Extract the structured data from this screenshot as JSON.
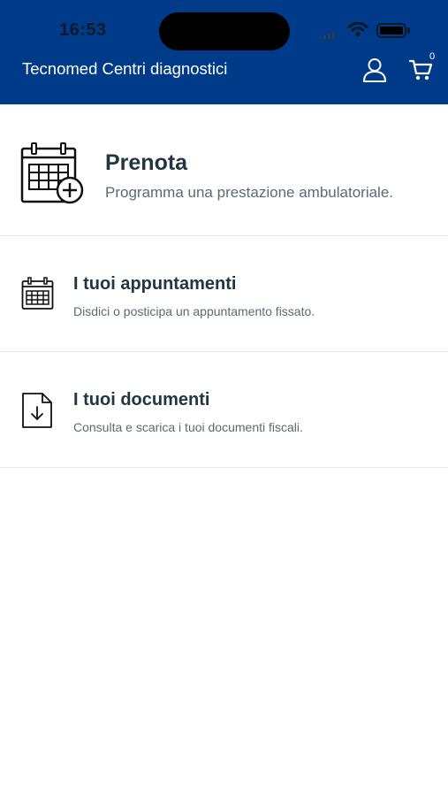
{
  "status_bar": {
    "time": "16:53",
    "icons": [
      "signal-icon",
      "wifi-icon",
      "battery-icon"
    ]
  },
  "header": {
    "title": "Tecnomed Centri diagnostici",
    "background": "#003b8a",
    "user_icon": "user-icon",
    "cart_icon": "cart-icon",
    "cart_count": "0"
  },
  "menu": {
    "prenota": {
      "title": "Prenota",
      "subtitle": "Programma una prestazione ambulatoriale.",
      "icon": "calendar-add-icon"
    },
    "appuntamenti": {
      "title": "I tuoi appuntamenti",
      "subtitle": "Disdici o posticipa un appuntamento fissato.",
      "icon": "calendar-icon"
    },
    "documenti": {
      "title": "I tuoi documenti",
      "subtitle": "Consulta e scarica i tuoi documenti fiscali.",
      "icon": "document-download-icon"
    }
  },
  "colors": {
    "title_text": "#213642",
    "subtitle_text": "#5b6a76",
    "divider": "#e6e6e6"
  }
}
